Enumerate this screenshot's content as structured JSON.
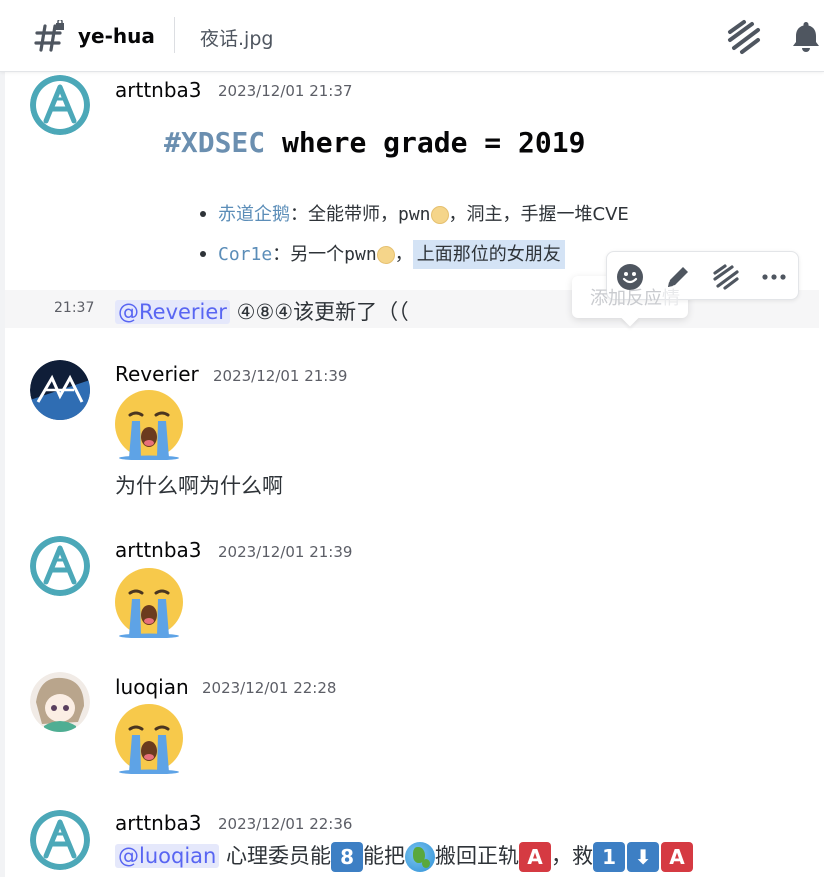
{
  "header": {
    "channel_name": "ye-hua",
    "topic": "夜话.jpg"
  },
  "messages": [
    {
      "username": "arttnba3",
      "timestamp": "2023/12/01 21:37",
      "heading_hash": "#",
      "heading_kw": "XDSEC",
      "heading_rest": " where grade = 2019",
      "bullets": [
        {
          "name": "赤道企鹅",
          "sep": "：",
          "text_a": "全能带师，pwn",
          "text_b": "，洞主，手握一堆CVE"
        },
        {
          "name": "Cor1e",
          "sep": "：",
          "text_a": "另一个pwn",
          "text_b": "，",
          "highlight": "上面那位的女朋友"
        }
      ]
    },
    {
      "timestamp": "21:37",
      "mention": "@Reverier",
      "text": " ④⑧④该更新了（（"
    },
    {
      "username": "Reverier",
      "timestamp": "2023/12/01 21:39",
      "emoji": "sob",
      "text": "为什么啊为什么啊"
    },
    {
      "username": "arttnba3",
      "timestamp": "2023/12/01 21:39",
      "emoji": "sob"
    },
    {
      "username": "luoqian",
      "timestamp": "2023/12/01 22:28",
      "emoji": "sob"
    },
    {
      "username": "arttnba3",
      "timestamp": "2023/12/01 22:36",
      "mention": "@luoqian",
      "text_a": " 心理委员能",
      "box_8": "8",
      "text_b": "能把",
      "text_c": "搬回正轨",
      "box_a1": "A",
      "text_d": "，救",
      "box_1": "1",
      "box_down": "⬇",
      "box_a2": "A"
    }
  ],
  "hover_toolbar": {
    "tooltip": "添加反应",
    "tooltip_hidden_suffix": "情"
  },
  "colors": {
    "accent_blurple": "#5865f2",
    "mention_bg": "#e5e8fb",
    "avatar_teal": "#4ca8b8"
  }
}
